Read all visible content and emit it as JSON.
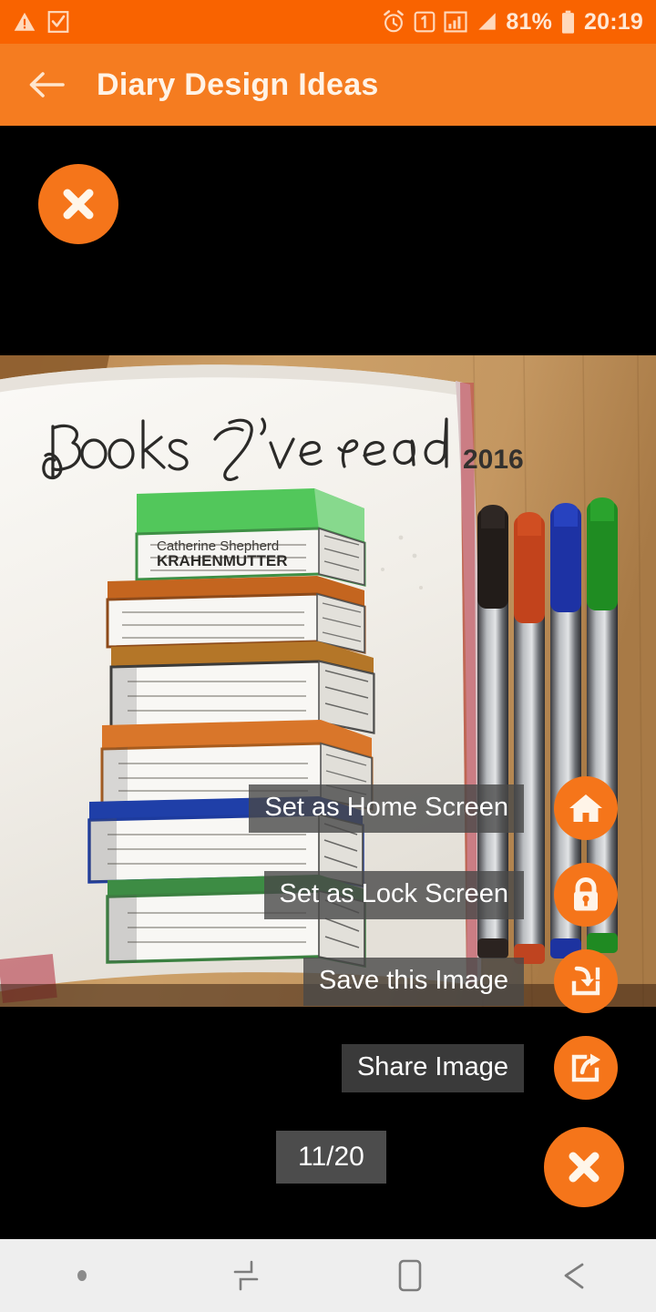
{
  "status_bar": {
    "background_color": "#f96300",
    "left_icons": [
      {
        "name": "warning-triangle-icon"
      },
      {
        "name": "checkbox-clipboard-icon"
      }
    ],
    "right_icons": [
      {
        "name": "alarm-clock-icon"
      },
      {
        "name": "sim-one-badge-icon",
        "label": "1"
      },
      {
        "name": "signal-bars-icon"
      },
      {
        "name": "signal-triangle-icon"
      }
    ],
    "battery_percent": "81%",
    "battery_icon": "battery-icon",
    "clock": "20:19"
  },
  "app_bar": {
    "background_color": "#f57c20",
    "back_icon": "back-arrow-icon",
    "title": "Diary Design Ideas"
  },
  "viewer": {
    "background_color": "#000000",
    "close_top": {
      "icon": "close-x-icon",
      "label": "Close"
    },
    "photo": {
      "alt": "Bullet journal page with hand-drawn stack of books titled Books I've read 2016 next to four felt-tip pens on a wooden desk",
      "headline": "Books J've read",
      "year": "2016",
      "book_label_author": "Catherine Shepherd",
      "book_label_title": "KRAHENMUTTER",
      "book_spine_colors": [
        "#3fc04a",
        "#c5651f",
        "#4a4a4a",
        "#d2701e",
        "#1f3ea8",
        "#3c8c44"
      ],
      "pen_cap_colors": [
        "#231a16",
        "#c0421c",
        "#1a32a6",
        "#1e8b22"
      ],
      "desk_color": "#c89a63",
      "page_color": "#f2efe9"
    },
    "actions": [
      {
        "name": "set-as-home-screen",
        "label": "Set as Home Screen",
        "icon": "home-icon"
      },
      {
        "name": "set-as-lock-screen",
        "label": "Set as Lock Screen",
        "icon": "lock-icon"
      },
      {
        "name": "save-this-image",
        "label": "Save this Image",
        "icon": "save-download-icon"
      },
      {
        "name": "share-image",
        "label": "Share Image",
        "icon": "share-icon"
      }
    ],
    "counter": "11/20",
    "close_bottom": {
      "icon": "close-x-icon",
      "label": "Close"
    },
    "accent_color": "#f5751a",
    "label_background": "rgba(72,72,72,0.80)"
  },
  "nav_bar": {
    "background_color": "#eeeeee",
    "items": [
      {
        "name": "nav-dot-indicator",
        "icon": "dot-icon"
      },
      {
        "name": "nav-recents-button",
        "icon": "recents-icon"
      },
      {
        "name": "nav-home-button",
        "icon": "home-square-icon"
      },
      {
        "name": "nav-back-button",
        "icon": "back-chevron-icon"
      }
    ]
  }
}
